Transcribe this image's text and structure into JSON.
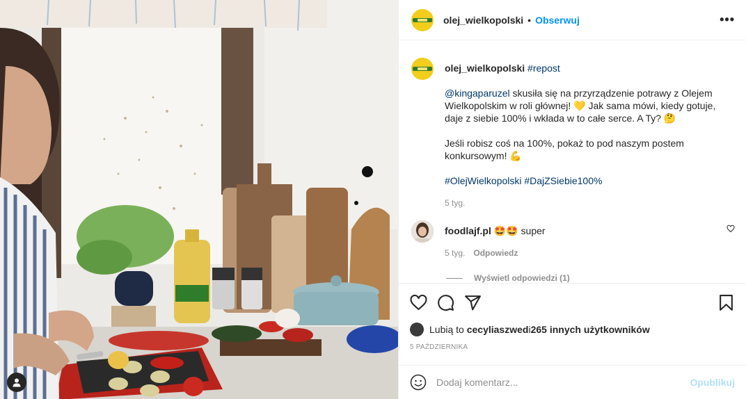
{
  "post": {
    "author": "olej_wielkopolski",
    "follow_label": "Obserwuj",
    "more_label": "•••",
    "photo": {
      "tag_icon": "user-tag-icon"
    },
    "caption": {
      "username": "olej_wielkopolski",
      "repost_tag": "#repost",
      "mention": "@kingaparuzel",
      "line1": " skusiła się na przyrządzenie potrawy z Olejem Wielkopolskim w roli głównej! ",
      "emoji1": "💛",
      "line2": " Jak sama mówi, kiedy gotuje, daje z siebie 100% i wkłada w to całe serce. A Ty? ",
      "emoji2": "🤔",
      "line3": "Jeśli robisz coś na 100%, pokaż to pod naszym postem konkursowym! ",
      "emoji3": "💪",
      "hashtag1": "#OlejWielkopolski",
      "hashtag2": "#DajZSiebie100%",
      "time": "5 tyg."
    },
    "comment": {
      "username": "foodlajf.pl",
      "emoji": "🤩🤩",
      "text": " super",
      "time": "5 tyg.",
      "reply_label": "Odpowiedz",
      "view_replies": "Wyświetl odpowiedzi (1)"
    },
    "likes": {
      "prefix": "Lubią to ",
      "user": "cecyliaszwed",
      "middle": " i ",
      "others": "265 innych użytkowników"
    },
    "date": "5 PAŹDZIERNIKA",
    "add_comment": {
      "placeholder": "Dodaj komentarz...",
      "post_label": "Opublikuj"
    }
  },
  "colors": {
    "link": "#0095f6",
    "tag": "#00376b",
    "muted": "#8e8e8e",
    "post_disabled": "#b2dffc"
  }
}
